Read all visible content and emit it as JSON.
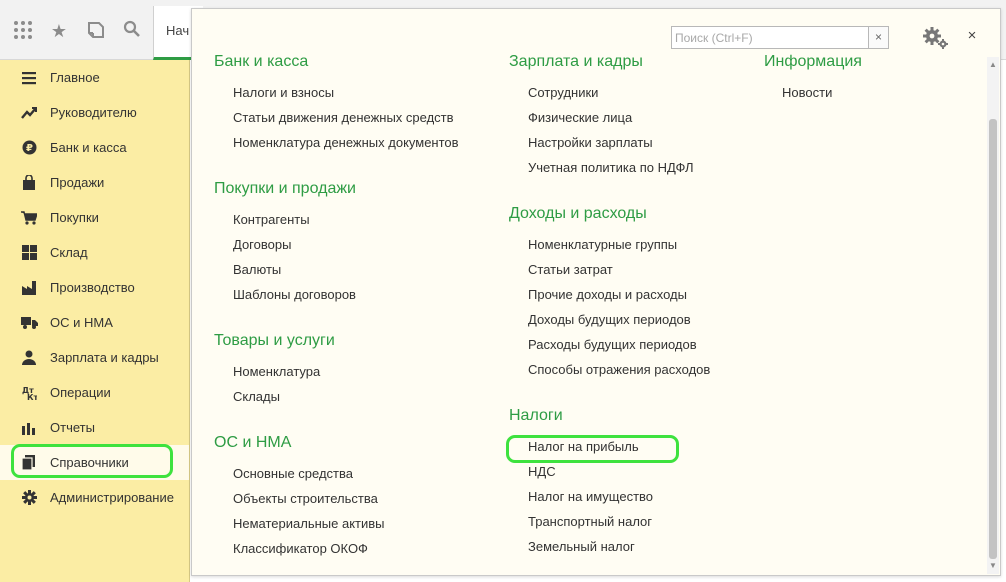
{
  "toolbar": {
    "icons": [
      "apps-grid-icon",
      "star-icon",
      "history-icon",
      "search-icon"
    ],
    "start_tab_label": "Нач"
  },
  "sidebar": {
    "items": [
      {
        "label": "Главное",
        "icon": "menu-icon"
      },
      {
        "label": "Руководителю",
        "icon": "trend-chart-icon"
      },
      {
        "label": "Банк и касса",
        "icon": "ruble-coin-icon"
      },
      {
        "label": "Продажи",
        "icon": "shopping-bag-icon"
      },
      {
        "label": "Покупки",
        "icon": "shopping-cart-icon"
      },
      {
        "label": "Склад",
        "icon": "warehouse-grid-icon"
      },
      {
        "label": "Производство",
        "icon": "factory-icon"
      },
      {
        "label": "ОС и НМА",
        "icon": "truck-icon"
      },
      {
        "label": "Зарплата и кадры",
        "icon": "person-icon"
      },
      {
        "label": "Операции",
        "icon": "debit-credit-icon"
      },
      {
        "label": "Отчеты",
        "icon": "bar-chart-icon"
      },
      {
        "label": "Справочники",
        "icon": "books-icon"
      },
      {
        "label": "Администрирование",
        "icon": "gear-icon"
      }
    ],
    "active_index": 11
  },
  "panel": {
    "search_placeholder": "Поиск (Ctrl+F)",
    "search_value": "",
    "search_clear": "×",
    "close": "×",
    "columns": [
      {
        "sections": [
          {
            "title": "Банк и касса",
            "items": [
              "Налоги и взносы",
              "Статьи движения денежных средств",
              "Номенклатура денежных документов"
            ]
          },
          {
            "title": "Покупки и продажи",
            "items": [
              "Контрагенты",
              "Договоры",
              "Валюты",
              "Шаблоны договоров"
            ]
          },
          {
            "title": "Товары и услуги",
            "items": [
              "Номенклатура",
              "Склады"
            ]
          },
          {
            "title": "ОС и НМА",
            "items": [
              "Основные средства",
              "Объекты строительства",
              "Нематериальные активы",
              "Классификатор ОКОФ"
            ]
          }
        ]
      },
      {
        "sections": [
          {
            "title": "Зарплата и кадры",
            "items": [
              "Сотрудники",
              "Физические лица",
              "Настройки зарплаты",
              "Учетная политика по НДФЛ"
            ]
          },
          {
            "title": "Доходы и расходы",
            "items": [
              "Номенклатурные группы",
              "Статьи затрат",
              "Прочие доходы и расходы",
              "Доходы будущих периодов",
              "Расходы будущих периодов",
              "Способы отражения расходов"
            ]
          },
          {
            "title": "Налоги",
            "items": [
              "Налог на прибыль",
              "НДС",
              "Налог на имущество",
              "Транспортный налог",
              "Земельный налог"
            ]
          }
        ]
      },
      {
        "sections": [
          {
            "title": "Информация",
            "items": [
              "Новости"
            ]
          }
        ]
      }
    ]
  },
  "colors": {
    "accent_green": "#2e9c44",
    "sidebar_bg": "#fbeda4",
    "highlight": "#3ee23e"
  }
}
